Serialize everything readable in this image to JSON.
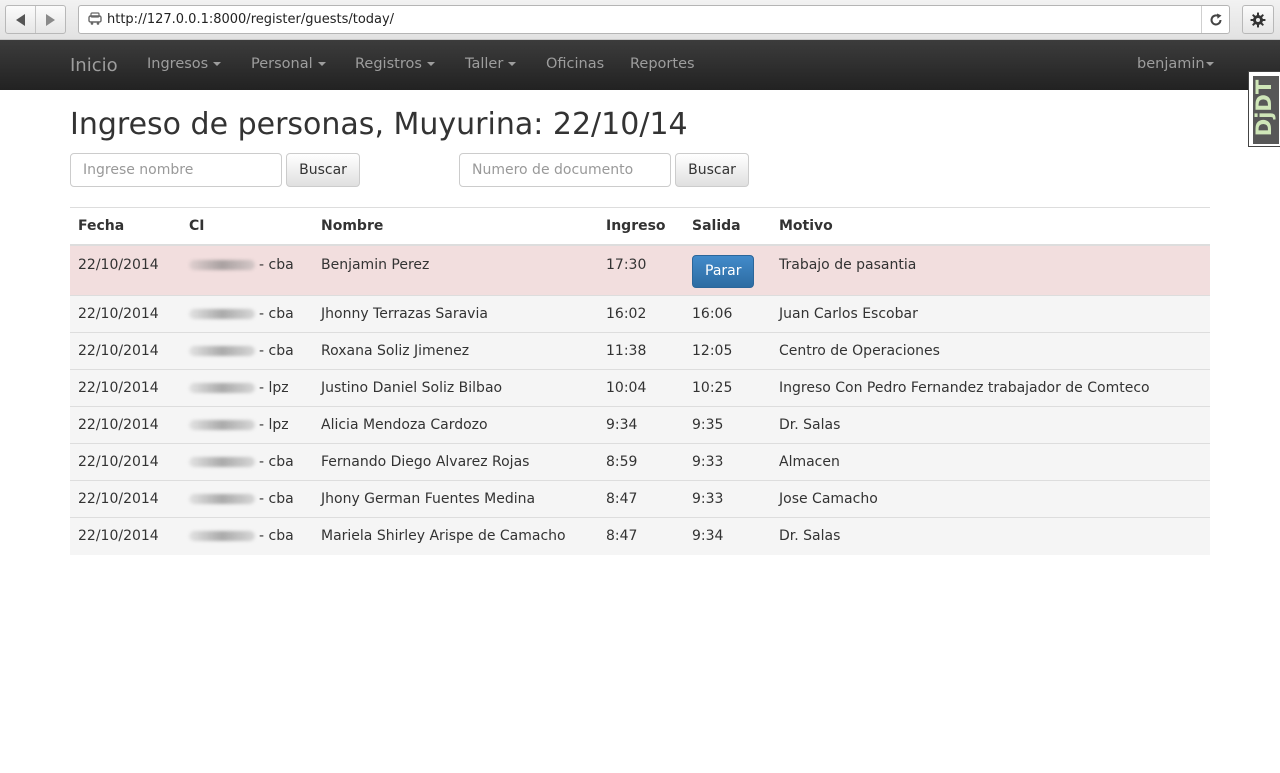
{
  "browser": {
    "url": "http://127.0.0.1:8000/register/guests/today/"
  },
  "navbar": {
    "brand": "Inicio",
    "items": [
      {
        "label": "Ingresos",
        "dropdown": true
      },
      {
        "label": "Personal",
        "dropdown": true
      },
      {
        "label": "Registros",
        "dropdown": true
      },
      {
        "label": "Taller",
        "dropdown": true
      },
      {
        "label": "Oficinas",
        "dropdown": false
      },
      {
        "label": "Reportes",
        "dropdown": false
      }
    ],
    "user": "benjamin"
  },
  "debug_toolbar": {
    "label": "DjDT"
  },
  "page": {
    "title": "Ingreso de personas, Muyurina: 22/10/14",
    "name_search": {
      "placeholder": "Ingrese nombre",
      "button": "Buscar"
    },
    "doc_search": {
      "placeholder": "Numero de documento",
      "button": "Buscar"
    }
  },
  "table": {
    "headers": [
      "Fecha",
      "CI",
      "Nombre",
      "Ingreso",
      "Salida",
      "Motivo"
    ],
    "rows": [
      {
        "fecha": "22/10/2014",
        "ci_suffix": "- cba",
        "nombre": "Benjamin Perez",
        "ingreso": "17:30",
        "salida": "",
        "salida_button": "Parar",
        "motivo": "Trabajo de pasantia",
        "active": true
      },
      {
        "fecha": "22/10/2014",
        "ci_suffix": "- cba",
        "nombre": "Jhonny Terrazas Saravia",
        "ingreso": "16:02",
        "salida": "16:06",
        "motivo": "Juan Carlos Escobar"
      },
      {
        "fecha": "22/10/2014",
        "ci_suffix": "- cba",
        "nombre": "Roxana Soliz Jimenez",
        "ingreso": "11:38",
        "salida": "12:05",
        "motivo": "Centro de Operaciones"
      },
      {
        "fecha": "22/10/2014",
        "ci_suffix": "- lpz",
        "nombre": "Justino Daniel Soliz Bilbao",
        "ingreso": "10:04",
        "salida": "10:25",
        "motivo": "Ingreso Con Pedro Fernandez trabajador de Comteco"
      },
      {
        "fecha": "22/10/2014",
        "ci_suffix": "- lpz",
        "nombre": "Alicia Mendoza Cardozo",
        "ingreso": "9:34",
        "salida": "9:35",
        "motivo": "Dr. Salas"
      },
      {
        "fecha": "22/10/2014",
        "ci_suffix": "- cba",
        "nombre": "Fernando Diego Alvarez Rojas",
        "ingreso": "8:59",
        "salida": "9:33",
        "motivo": "Almacen"
      },
      {
        "fecha": "22/10/2014",
        "ci_suffix": "- cba",
        "nombre": "Jhony German Fuentes Medina",
        "ingreso": "8:47",
        "salida": "9:33",
        "motivo": "Jose Camacho"
      },
      {
        "fecha": "22/10/2014",
        "ci_suffix": "- cba",
        "nombre": "Mariela Shirley Arispe de Camacho",
        "ingreso": "8:47",
        "salida": "9:34",
        "motivo": "Dr. Salas"
      }
    ]
  },
  "colors": {
    "navbar_bg": "#222222",
    "nav_text": "#9d9d9d",
    "active_row": "#f2dede",
    "primary_button": "#428bca"
  }
}
